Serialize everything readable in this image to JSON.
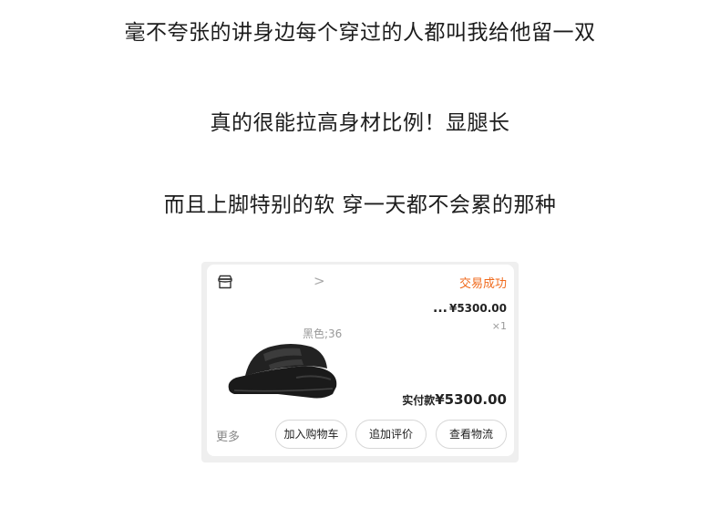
{
  "text_lines": [
    "毫不夸张的讲身边每个穿过的人都叫我给他留一双",
    "真的很能拉高身材比例！显腿长",
    "而且上脚特别的软 穿一天都不会累的那种"
  ],
  "order_card": {
    "status": "交易成功",
    "chevron": ">",
    "product_name": "...",
    "price": "¥5300.00",
    "quantity": "×1",
    "variant": "黑色;36",
    "total_label": "实付款",
    "total_amount": "¥5300.00",
    "more_label": "更多",
    "buttons": [
      "加入购物车",
      "追加评价",
      "查看物流"
    ]
  },
  "colors": {
    "accent": "#f06a1c"
  },
  "icons": {
    "store": "store-icon"
  }
}
